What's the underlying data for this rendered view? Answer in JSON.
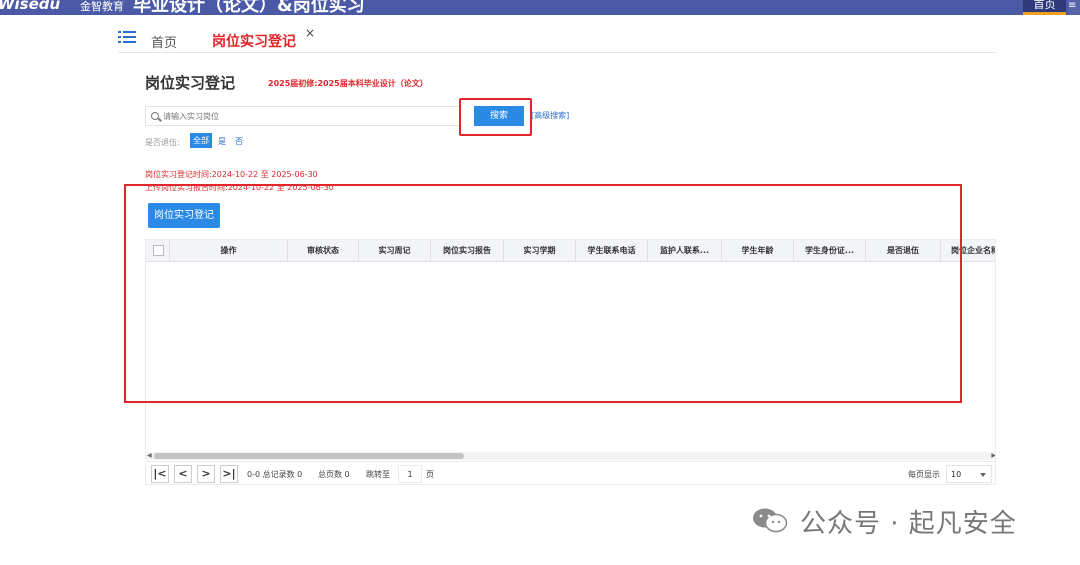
{
  "header": {
    "logo": "Wisedu",
    "logo_sub": "金智教育",
    "app_title": "毕业设计（论文）&岗位实习",
    "home": "首页",
    "extra": "≡"
  },
  "tabs": {
    "home": "首页",
    "active": "岗位实习登记",
    "close": "×"
  },
  "page": {
    "title": "岗位实习登记",
    "batch": "2025届初修:2025届本科毕业设计（论文）"
  },
  "search": {
    "placeholder": "请输入实习岗位",
    "button": "搜索",
    "advanced": "[高级搜索]"
  },
  "filter": {
    "label": "是否退伍:",
    "all": "全部",
    "yes": "是",
    "no": "否"
  },
  "periods": {
    "register": "岗位实习登记时间:2024-10-22 至 2025-06-30",
    "upload": "上传岗位实习报告时间:2024-10-22 至 2025-06-30"
  },
  "register_button": "岗位实习登记",
  "grid": {
    "columns": [
      "操作",
      "审核状态",
      "实习周记",
      "岗位实习报告",
      "实习学期",
      "学生联系电话",
      "监护人联系...",
      "学生年龄",
      "学生身份证...",
      "是否退伍",
      "岗位企业名称"
    ]
  },
  "pager": {
    "first": "|<",
    "prev": "<",
    "next": ">",
    "last": ">|",
    "records": "0-0 总记录数 0",
    "pages": "总页数 0",
    "jump": "跳转至",
    "page_value": "1",
    "page_unit": "页",
    "per_page_label": "每页显示",
    "per_page": "10"
  },
  "watermark": "公众号 · 起凡安全",
  "colors": {
    "topbar": "#4b5aa6",
    "accent": "#2a8ae6",
    "red": "#e0262b"
  }
}
